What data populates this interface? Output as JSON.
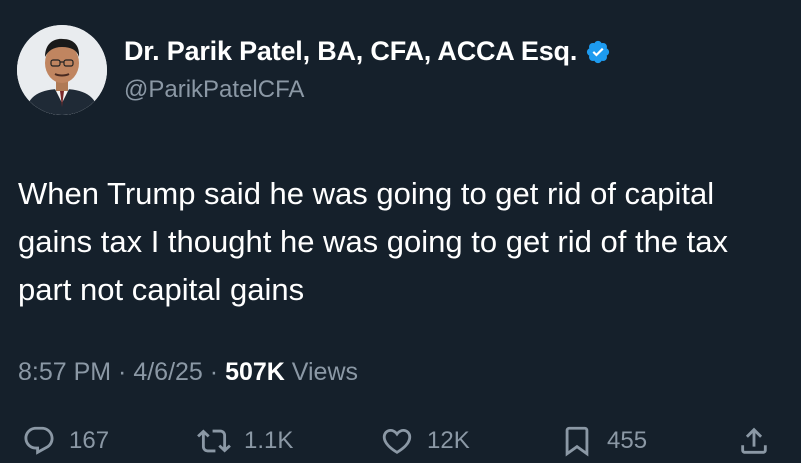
{
  "author": {
    "display_name": "Dr. Parik Patel, BA, CFA, ACCA Esq.",
    "handle": "@ParikPatelCFA",
    "verified_icon": "verified-badge-icon"
  },
  "tweet": {
    "text": "When Trump said he was going to get rid of capital gains tax I thought he was going to get rid of the tax part not capital gains"
  },
  "meta": {
    "time": "8:57 PM",
    "sep1": " · ",
    "date": "4/6/25",
    "sep2": " · ",
    "views_count": "507K",
    "views_label": " Views"
  },
  "actions": {
    "replies": "167",
    "reposts": "1.1K",
    "likes": "12K",
    "bookmarks": "455"
  },
  "colors": {
    "background": "#15202b",
    "text_primary": "#ffffff",
    "text_secondary": "#8b98a5",
    "verified_blue": "#1d9bf0"
  }
}
